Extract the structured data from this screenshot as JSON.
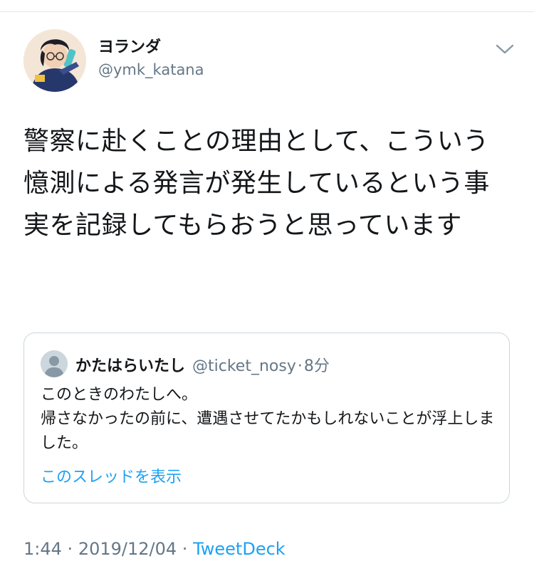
{
  "tweet": {
    "author_name": "ヨランダ",
    "author_handle": "@ymk_katana",
    "text": "警察に赴くことの理由として、こういう憶測による発言が発生しているという事実を記録してもらおうと思っています",
    "time": "1:44",
    "date": "2019/12/04",
    "separator": "·",
    "source": "TweetDeck",
    "icons": {
      "avatar": "profile-avatar-illustration",
      "menu": "chevron-down-icon"
    }
  },
  "quoted_tweet": {
    "author_name": "かたはらいたし",
    "author_handle": "@ticket_nosy",
    "separator": "·",
    "time_ago": "8分",
    "text": "このときのわたしへ。\n帰さなかったの前に、遭遇させてたかもしれないことが浮上しました。",
    "show_thread_label": "このスレッドを表示",
    "icons": {
      "avatar": "default-user-icon"
    }
  },
  "colors": {
    "primary_text": "#14171a",
    "secondary_text": "#657786",
    "link": "#1da1f2",
    "border": "#ccd6dd"
  }
}
